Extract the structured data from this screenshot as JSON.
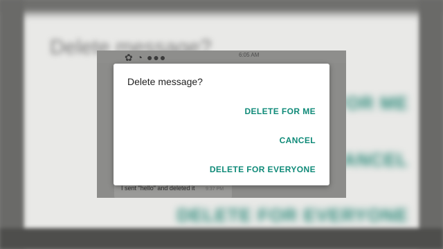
{
  "dialog": {
    "title": "Delete message?",
    "actions": {
      "delete_for_me": "DELETE FOR ME",
      "cancel": "CANCEL",
      "delete_for_everyone": "DELETE FOR EVERYONE"
    },
    "accent_color": "#0f8a78"
  },
  "chat": {
    "top_time": "6:05 AM",
    "bottom_message": "I sent \"hello\" and deleted it",
    "bottom_time": "9:37 PM"
  }
}
